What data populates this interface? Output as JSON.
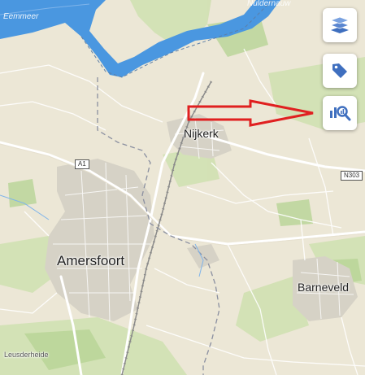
{
  "map": {
    "labels": {
      "top_left_water": "Eemmeer",
      "top_right_water": "Nuldernauw",
      "nijkerk": "Nijkerk",
      "amersfoort": "Amersfoort",
      "barneveld": "Barneveld",
      "leusderheide": "Leusderheide"
    },
    "road_shields": {
      "a1": "A1",
      "n303": "N303"
    }
  },
  "controls": [
    {
      "name": "layers-button",
      "icon": "layers-icon"
    },
    {
      "name": "tags-button",
      "icon": "tag-icon"
    },
    {
      "name": "analysis-button",
      "icon": "chart-search-icon"
    }
  ],
  "annotation": {
    "arrow_color": "#e02020"
  },
  "colors": {
    "land": "#ece7d6",
    "water": "#4a97e0",
    "urban": "#d6d2c6",
    "forest": "#c9dca8",
    "roads": "#ffffff",
    "icon_blue": "#3f6fbf"
  }
}
